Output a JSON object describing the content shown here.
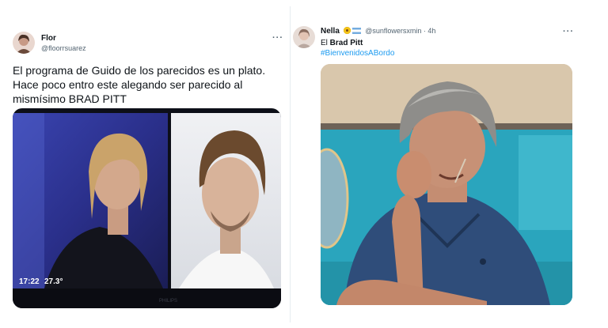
{
  "tweet1": {
    "author_name": "Flor",
    "author_handle": "@floorrsuarez",
    "more_label": "···",
    "text_line1": "El programa de Guido de los parecidos es un plato.",
    "text_line2": "Hace poco entro este alegando ser parecido al",
    "text_line3": "mismísimo BRAD PITT",
    "tv_time": "17:22",
    "tv_temp": "27.3°",
    "tv_brand": "PHILIPS"
  },
  "tweet2": {
    "author_name": "Nella",
    "author_handle": "@sunflowersxmin · 4h",
    "more_label": "···",
    "text_prefix": "El ",
    "text_bold": "Brad Pitt",
    "hashtag": "#BienvenidosABordo"
  },
  "colors": {
    "link": "#1d9bf0",
    "secondary": "#536471",
    "divider": "#e6ecf0"
  }
}
